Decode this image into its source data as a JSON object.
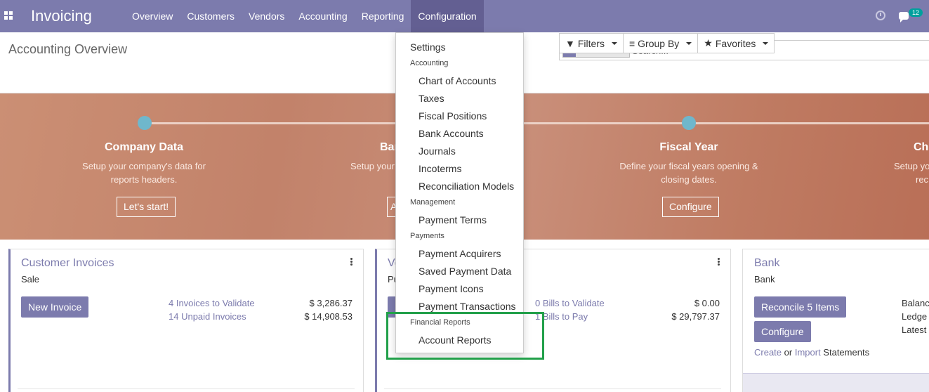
{
  "navbar": {
    "brand": "Invoicing",
    "menu": [
      "Overview",
      "Customers",
      "Vendors",
      "Accounting",
      "Reporting",
      "Configuration"
    ],
    "active_menu": "Configuration",
    "message_count": "12",
    "color": "#7c7bad"
  },
  "control_panel": {
    "title": "Accounting Overview",
    "search": {
      "facet": "Favorites",
      "placeholder": "Search..."
    },
    "filters_label": "Filters",
    "groupby_label": "Group By",
    "favorites_label": "Favorites"
  },
  "onboarding": {
    "steps": [
      {
        "title": "Company Data",
        "desc_line1": "Setup your company's data for",
        "desc_line2": "reports headers.",
        "button": "Let's start!"
      },
      {
        "title": "Bank",
        "desc_line1": "Setup your",
        "desc_line2": ""
      },
      {
        "title": "Fiscal Year",
        "desc_line1": "Define your fiscal years opening &",
        "desc_line2": "closing dates.",
        "button": "Configure"
      },
      {
        "title": "Ch",
        "desc_line1": "Setup yo",
        "desc_line2": "rec"
      }
    ]
  },
  "cards": {
    "customer_invoices": {
      "title": "Customer Invoices",
      "subtitle": "Sale",
      "button": "New Invoice",
      "stat1_label": "4 Invoices to Validate",
      "stat1_value": "$ 3,286.37",
      "stat2_label": "14 Unpaid Invoices",
      "stat2_value": "$ 14,908.53"
    },
    "vendor_bills": {
      "title_partial": "Ve",
      "subtitle_partial": "Pu",
      "stat1_label": "0 Bills to Validate",
      "stat1_value": "$ 0.00",
      "stat2_label": "1 Bills to Pay",
      "stat2_value": "$ 29,797.37"
    },
    "bank": {
      "title": "Bank",
      "subtitle": "Bank",
      "button1": "Reconcile 5 Items",
      "button2": "Configure",
      "create_link": "Create",
      "or_text": "or",
      "import_link": "Import",
      "statements_text": "Statements",
      "side_labels": [
        "Balanc",
        "Ledge",
        "Latest"
      ]
    }
  },
  "config_menu": {
    "settings": "Settings",
    "sections": [
      {
        "header": "Accounting",
        "items": [
          "Chart of Accounts",
          "Taxes",
          "Fiscal Positions",
          "Bank Accounts",
          "Journals",
          "Incoterms",
          "Reconciliation Models"
        ]
      },
      {
        "header": "Management",
        "items": [
          "Payment Terms"
        ]
      },
      {
        "header": "Payments",
        "items": [
          "Payment Acquirers",
          "Saved Payment Data",
          "Payment Icons",
          "Payment Transactions"
        ]
      },
      {
        "header": "Financial Reports",
        "items": [
          "Account Reports"
        ]
      }
    ],
    "highlight_color": "#22a04a"
  }
}
